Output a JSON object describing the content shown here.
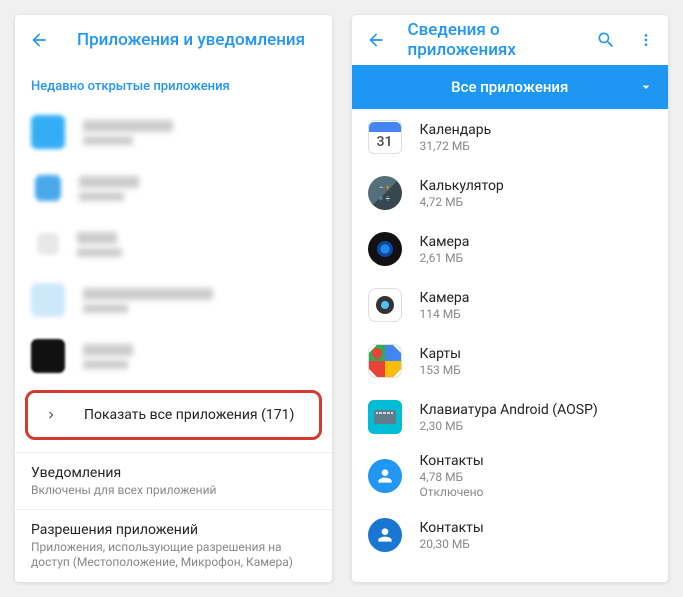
{
  "left": {
    "title": "Приложения и уведомления",
    "section_title": "Недавно открытые приложения",
    "show_all": "Показать все приложения (171)",
    "settings": {
      "notifications": {
        "title": "Уведомления",
        "sub": "Включены для всех приложений"
      },
      "permissions": {
        "title": "Разрешения приложений",
        "sub": "Приложения, использующие разрешения на доступ (Местоположение, Микрофон, Камера)"
      }
    }
  },
  "right": {
    "title": "Сведения о приложениях",
    "all_apps": "Все приложения",
    "apps": [
      {
        "name": "Календарь",
        "sub": "31,72 МБ",
        "icon_bg": "#4285f4",
        "icon_label": "31"
      },
      {
        "name": "Калькулятор",
        "sub": "4,72 МБ",
        "icon_bg": "#455a64",
        "icon_label": ""
      },
      {
        "name": "Камера",
        "sub": "2,61 МБ",
        "icon_bg": "#111",
        "icon_label": ""
      },
      {
        "name": "Камера",
        "sub": "114 МБ",
        "icon_bg": "#fff",
        "icon_label": ""
      },
      {
        "name": "Карты",
        "sub": "153 МБ",
        "icon_bg": "#fff",
        "icon_label": ""
      },
      {
        "name": "Клавиатура Android (AOSP)",
        "sub": "2,30 МБ",
        "icon_bg": "#607d8b",
        "icon_label": ""
      },
      {
        "name": "Контакты",
        "sub": "4,78 МБ",
        "sub2": "Отключено",
        "icon_bg": "#2196f3",
        "icon_label": ""
      },
      {
        "name": "Контакты",
        "sub": "20,30 МБ",
        "icon_bg": "#2196f3",
        "icon_label": ""
      }
    ]
  }
}
